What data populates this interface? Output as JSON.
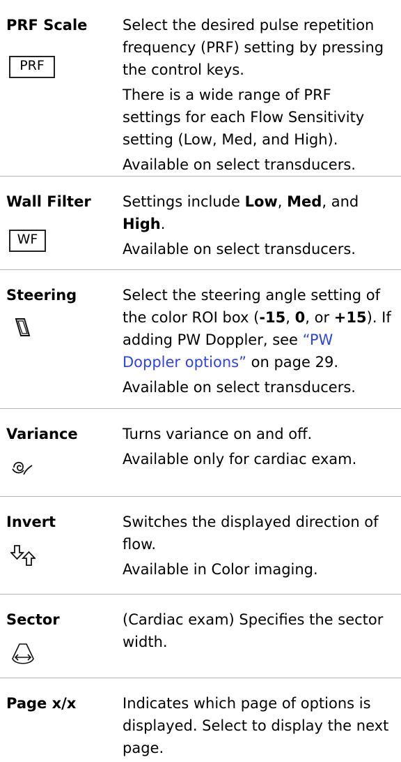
{
  "rows": [
    {
      "name": "PRF Scale",
      "icon": "prf-icon",
      "icon_text": "PRF",
      "desc": [
        "Select the desired pulse repetition frequency (PRF) setting by pressing the control keys.",
        "There is a wide range of PRF settings for each Flow Sensitivity setting (Low, Med, and High).",
        "Available on select transducers."
      ]
    },
    {
      "name": "Wall Filter",
      "icon": "wf-icon",
      "icon_text": "WF",
      "desc_intro": "Settings include ",
      "desc_low": "Low",
      "desc_sep1": ", ",
      "desc_med": "Med",
      "desc_sep2": ", and ",
      "desc_high": "High",
      "desc_end": ".",
      "desc2": "Available on select transducers."
    },
    {
      "name": "Steering",
      "icon": "steering-icon",
      "desc_a": "Select the steering angle setting of the color ROI box (",
      "desc_m15": "-15",
      "desc_c1": ", ",
      "desc_0": "0",
      "desc_c2": ", or ",
      "desc_p15": "+15",
      "desc_b": "). If adding PW Doppler, see ",
      "link": "“PW Doppler options”",
      "desc_c": " on page 29.",
      "desc2": "Available on select transducers."
    },
    {
      "name": "Variance",
      "icon": "variance-icon",
      "desc": [
        "Turns variance on and off.",
        "Available only for cardiac exam."
      ]
    },
    {
      "name": "Invert",
      "icon": "invert-icon",
      "desc": [
        "Switches the displayed direction of flow.",
        "Available in Color imaging."
      ]
    },
    {
      "name": "Sector",
      "icon": "sector-icon",
      "desc": [
        "(Cardiac exam) Specifies the sector width."
      ]
    },
    {
      "name": "Page x/x",
      "desc": [
        "Indicates which page of options is displayed. Select to display the next page."
      ]
    }
  ]
}
